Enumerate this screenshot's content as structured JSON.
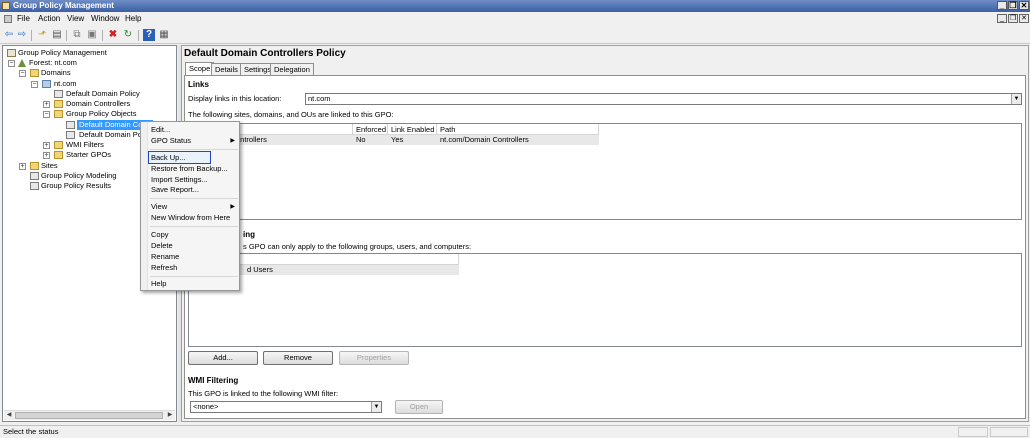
{
  "window": {
    "title": "Group Policy Management",
    "minimize": "_",
    "restore": "❐",
    "close": "✕"
  },
  "menubar": {
    "items": [
      "File",
      "Action",
      "View",
      "Window",
      "Help"
    ]
  },
  "toolbar": {
    "icons": [
      "back-icon",
      "forward-icon",
      "up-icon",
      "show-hide-tree-icon",
      "copy-icon",
      "paste-icon",
      "delete-icon",
      "refresh-icon",
      "help-icon",
      "properties-icon"
    ]
  },
  "tree": {
    "root": "Group Policy Management",
    "forest": "Forest: nt.com",
    "domains": "Domains",
    "domain": "nt.com",
    "default_domain_policy": "Default Domain Policy",
    "domain_controllers": "Domain Controllers",
    "gpo_folder": "Group Policy Objects",
    "gpo_selected": "Default Domain Contr",
    "gpo_other": "Default Domain Polic",
    "wmi_filters": "WMI Filters",
    "starter_gpos": "Starter GPOs",
    "sites": "Sites",
    "modeling": "Group Policy Modeling",
    "results": "Group Policy Results"
  },
  "context_menu": {
    "items": [
      "Edit...",
      "GPO Status",
      "Back Up...",
      "Restore from Backup...",
      "Import Settings...",
      "Save Report...",
      "View",
      "New Window from Here",
      "Copy",
      "Delete",
      "Rename",
      "Refresh",
      "Help"
    ],
    "highlighted": "Back Up..."
  },
  "details": {
    "title": "Default Domain Controllers Policy",
    "tabs": [
      "Scope",
      "Details",
      "Settings",
      "Delegation"
    ],
    "active_tab": "Scope",
    "links": {
      "heading": "Links",
      "display_label": "Display links in this location:",
      "location_value": "nt.com",
      "linked_caption": "The following sites, domains, and OUs are linked to this GPO:",
      "columns": [
        "",
        "Enforced",
        "Link Enabled",
        "Path"
      ],
      "rows": [
        {
          "location": "ontrollers",
          "enforced": "No",
          "link_enabled": "Yes",
          "path": "nt.com/Domain Controllers"
        }
      ]
    },
    "security": {
      "heading": "ing",
      "caption": "s GPO can only apply to the following groups, users, and computers:",
      "row": "d Users",
      "add": "Add...",
      "remove": "Remove",
      "properties": "Properties"
    },
    "wmi": {
      "heading": "WMI Filtering",
      "caption": "This GPO is linked to the following WMI filter:",
      "value": "<none>",
      "open": "Open"
    }
  },
  "statusbar": {
    "text": "Select the status"
  }
}
